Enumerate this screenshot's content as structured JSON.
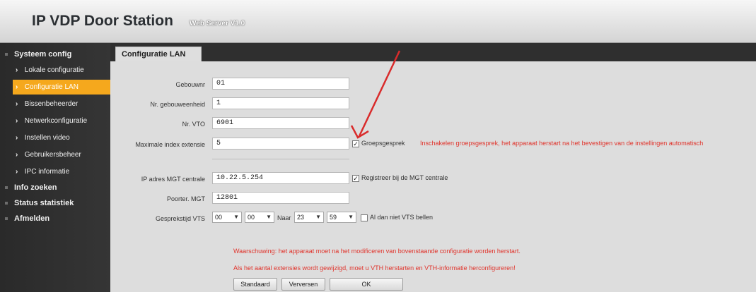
{
  "header": {
    "title": "IP VDP Door Station",
    "subtitle": "Web Server V1.0"
  },
  "sidebar": {
    "systeem_config": "Systeem config",
    "items": [
      {
        "label": "Lokale configuratie"
      },
      {
        "label": "Configuratie LAN"
      },
      {
        "label": "Bissenbeheerder"
      },
      {
        "label": "Netwerkconfiguratie"
      },
      {
        "label": "Instellen video"
      },
      {
        "label": "Gebruikersbeheer"
      },
      {
        "label": "IPC informatie"
      }
    ],
    "info_zoeken": "Info zoeken",
    "status": "Status statistiek",
    "afmelden": "Afmelden"
  },
  "tab": {
    "label": "Configuratie LAN"
  },
  "form": {
    "gebouw_label": "Gebouwnr",
    "gebouw_value": "01",
    "eenheid_label": "Nr. gebouweenheid",
    "eenheid_value": "1",
    "vto_label": "Nr. VTO",
    "vto_value": "6901",
    "max_label": "Maximale index extensie",
    "max_value": "5",
    "groep_label": "Groepsgesprek",
    "groep_checked": true,
    "groep_warning": "Inschakelen groepsgesprek, het apparaat herstart na het bevestigen van de instellingen automatisch",
    "mgt_label": "IP adres MGT centrale",
    "mgt_value": "10.22.5.254",
    "registreer_label": "Registreer bij de MGT centrale",
    "registreer_checked": true,
    "poort_label": "Poorter. MGT",
    "poort_value": "12801",
    "vts_label": "Gesprekstijd VTS",
    "vts_from_h": "00",
    "vts_from_m": "00",
    "naar_label": "Naar",
    "vts_to_h": "23",
    "vts_to_m": "59",
    "niet_vts_label": "Al dan niet VTS bellen",
    "niet_vts_checked": false,
    "warning1": "Waarschuwing: het apparaat moet na het modificeren van bovenstaande configuratie worden herstart.",
    "warning2": "Als het aantal extensies wordt gewijzigd, moet u VTH herstarten en VTH-informatie herconfigureren!"
  },
  "buttons": {
    "standaard": "Standaard",
    "verversen": "Verversen",
    "ok": "OK"
  },
  "colors": {
    "accent": "#f5a81d",
    "warning": "#e0332b",
    "annotation_arrow": "#d92b2b"
  }
}
